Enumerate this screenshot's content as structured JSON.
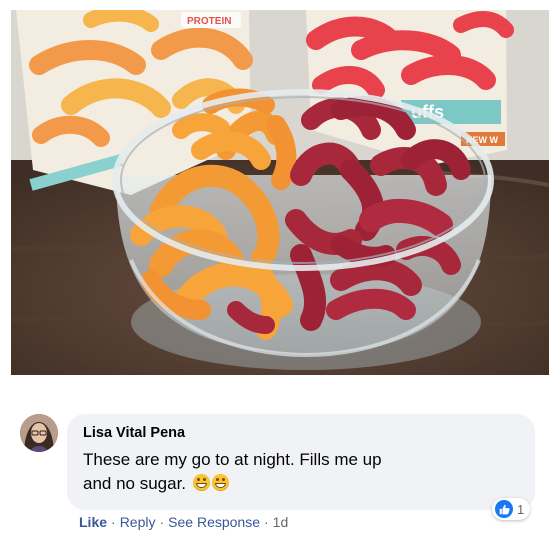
{
  "post": {
    "photo_alt": "",
    "bag_left_text": "PROTEIN",
    "bag_right_text": "uffs",
    "bag_right_small": "NEW W"
  },
  "comment": {
    "author": "Lisa Vital Pena",
    "text": "These are my go to at night. Fills me up and no sugar.",
    "emoji": [
      "grinning-face",
      "grinning-face"
    ]
  },
  "actions": {
    "like": "Like",
    "reply": "Reply",
    "see_response": "See Response",
    "time": "1d",
    "separator": "·"
  },
  "reactions": {
    "count": "1",
    "type": "like"
  },
  "colors": {
    "link": "#385898",
    "meta": "#65676b",
    "bubble": "#f0f2f5",
    "like_blue": "#1877f2"
  }
}
